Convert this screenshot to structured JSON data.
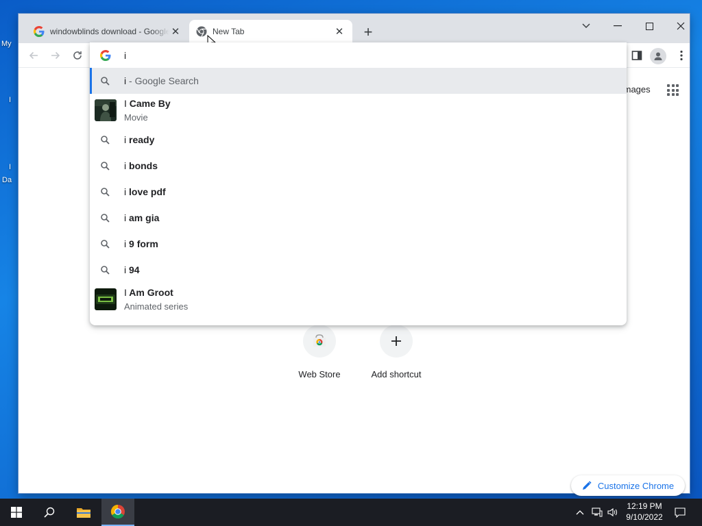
{
  "desktop": {
    "labels": [
      "My",
      "I",
      "I",
      "Da"
    ]
  },
  "browser": {
    "tabs": [
      {
        "title": "windowblinds download - Google Search",
        "favicon": "google-g-icon",
        "active": false
      },
      {
        "title": "New Tab",
        "favicon": "chrome-icon",
        "active": true
      }
    ],
    "new_tab_label": "+"
  },
  "omnibox": {
    "value": "i",
    "provider_icon": "google-g-icon",
    "suggestions": [
      {
        "typed": "i",
        "rest": "",
        "desc": " - Google Search",
        "icon": "search-icon",
        "selected": true
      },
      {
        "typed": "I",
        "rest": " Came By",
        "sub": "Movie",
        "icon": "thumbnail"
      },
      {
        "typed": "i",
        "rest": " ready",
        "icon": "search-icon"
      },
      {
        "typed": "i",
        "rest": " bonds",
        "icon": "search-icon"
      },
      {
        "typed": "i",
        "rest": " love pdf",
        "icon": "search-icon"
      },
      {
        "typed": "i",
        "rest": " am gia",
        "icon": "search-icon"
      },
      {
        "typed": "i",
        "rest": " 9 form",
        "icon": "search-icon"
      },
      {
        "typed": "i",
        "rest": " 94",
        "icon": "search-icon"
      },
      {
        "typed": "I",
        "rest": " Am Groot",
        "sub": "Animated series",
        "icon": "thumbnail"
      }
    ]
  },
  "newtab": {
    "images_link": "Images",
    "shortcuts": [
      {
        "label": "Web Store",
        "icon": "chrome-web-store-icon"
      },
      {
        "label": "Add shortcut",
        "icon": "plus-icon"
      }
    ],
    "customize_label": "Customize Chrome"
  },
  "taskbar": {
    "time": "12:19 PM",
    "date": "9/10/2022"
  },
  "colors": {
    "accent": "#1a73e8",
    "tabstrip": "#dee1e6",
    "taskbar": "#1b1d23"
  }
}
